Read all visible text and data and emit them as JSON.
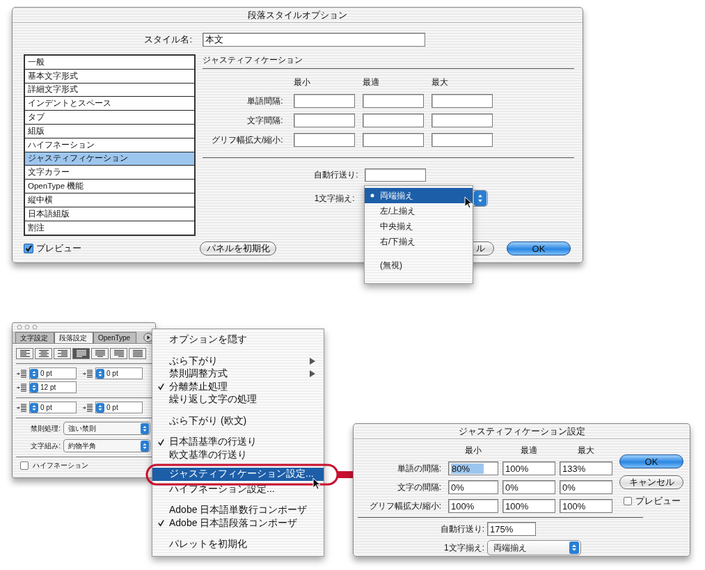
{
  "style_dialog": {
    "title": "段落スタイルオプション",
    "style_name_label": "スタイル名:",
    "style_name_value": "本文",
    "categories": [
      {
        "label": "一般",
        "selected": false
      },
      {
        "label": "基本文字形式",
        "selected": false
      },
      {
        "label": "詳細文字形式",
        "selected": false
      },
      {
        "label": "インデントとスペース",
        "selected": false
      },
      {
        "label": "タブ",
        "selected": false
      },
      {
        "label": "組版",
        "selected": false
      },
      {
        "label": "ハイフネーション",
        "selected": false
      },
      {
        "label": "ジャスティフィケーション",
        "selected": true
      },
      {
        "label": "文字カラー",
        "selected": false
      },
      {
        "label": "OpenType 機能",
        "selected": false
      },
      {
        "label": "縦中横",
        "selected": false
      },
      {
        "label": "日本語組版",
        "selected": false
      },
      {
        "label": "割注",
        "selected": false
      }
    ],
    "section_title": "ジャスティフィケーション",
    "columns": [
      "最小",
      "最適",
      "最大"
    ],
    "rows": [
      {
        "label": "単語間隔:"
      },
      {
        "label": "文字間隔:"
      },
      {
        "label": "グリフ幅拡大/縮小:"
      }
    ],
    "auto_leading_label": "自動行送り:",
    "single_char_label": "1文字揃え:",
    "preview": {
      "label": "プレビュー",
      "checked": true
    },
    "reset_button": "パネルを初期化",
    "cancel_button": "ル",
    "ok_button": "OK"
  },
  "alignment_menu": {
    "groups": [
      [
        {
          "label": "両端揃え",
          "selected": true
        },
        {
          "label": "左/上揃え",
          "selected": false
        },
        {
          "label": "中央揃え",
          "selected": false
        },
        {
          "label": "右/下揃え",
          "selected": false
        }
      ],
      [
        {
          "label": "(無視)",
          "selected": false
        }
      ]
    ]
  },
  "palette": {
    "tabs": [
      {
        "label": "文字設定",
        "selected": false
      },
      {
        "label": "段落設定",
        "selected": true
      },
      {
        "label": "OpenType",
        "selected": false
      }
    ],
    "alignment_buttons": [
      {
        "selected": false
      },
      {
        "selected": false
      },
      {
        "selected": false
      },
      {
        "selected": true
      },
      {
        "selected": false
      },
      {
        "selected": false
      },
      {
        "selected": false
      }
    ],
    "indents": [
      {
        "value": "0 pt"
      },
      {
        "value": "0 pt"
      },
      {
        "value": "12 pt"
      },
      {
        "value": "0 pt"
      },
      {
        "value": "0 pt"
      }
    ],
    "kinsoku": {
      "label": "禁則処理:",
      "value": "強い禁則"
    },
    "mojikumi": {
      "label": "文字組み:",
      "value": "約物半角"
    },
    "hyphenation": {
      "label": "ハイフネーション",
      "checked": false
    }
  },
  "panel_menu": {
    "groups": [
      [
        {
          "label": "オプションを隠す",
          "checked": false,
          "submenu": false,
          "selected": false
        }
      ],
      [
        {
          "label": "ぶら下がり",
          "checked": false,
          "submenu": true,
          "selected": false
        },
        {
          "label": "禁則調整方式",
          "checked": false,
          "submenu": true,
          "selected": false
        },
        {
          "label": "分離禁止処理",
          "checked": true,
          "submenu": false,
          "selected": false
        },
        {
          "label": "繰り返し文字の処理",
          "checked": false,
          "submenu": false,
          "selected": false
        }
      ],
      [
        {
          "label": "ぶら下がり (欧文)",
          "checked": false,
          "submenu": false,
          "selected": false
        }
      ],
      [
        {
          "label": "日本語基準の行送り",
          "checked": true,
          "submenu": false,
          "selected": false
        },
        {
          "label": "欧文基準の行送り",
          "checked": false,
          "submenu": false,
          "selected": false
        }
      ],
      [
        {
          "label": "ジャスティフィケーション設定...",
          "checked": false,
          "submenu": false,
          "selected": true
        },
        {
          "label": "ハイフネーション設定...",
          "checked": false,
          "submenu": false,
          "selected": false
        }
      ],
      [
        {
          "label": "Adobe 日本語単数行コンポーザ",
          "checked": false,
          "submenu": false,
          "selected": false
        },
        {
          "label": "Adobe 日本語段落コンポーザ",
          "checked": true,
          "submenu": false,
          "selected": false
        }
      ],
      [
        {
          "label": "パレットを初期化",
          "checked": false,
          "submenu": false,
          "selected": false
        }
      ]
    ]
  },
  "justification_dialog": {
    "title": "ジャスティフィケーション設定",
    "columns": [
      "最小",
      "最適",
      "最大"
    ],
    "rows": [
      {
        "label": "単語の間隔:",
        "values": [
          {
            "text": "80%",
            "selected": true
          },
          {
            "text": "100%",
            "selected": false
          },
          {
            "text": "133%",
            "selected": false
          }
        ]
      },
      {
        "label": "文字の間隔:",
        "values": [
          {
            "text": "0%",
            "selected": false
          },
          {
            "text": "0%",
            "selected": false
          },
          {
            "text": "0%",
            "selected": false
          }
        ]
      },
      {
        "label": "グリフ幅拡大/縮小:",
        "values": [
          {
            "text": "100%",
            "selected": false
          },
          {
            "text": "100%",
            "selected": false
          },
          {
            "text": "100%",
            "selected": false
          }
        ]
      }
    ],
    "auto_leading_label": "自動行送り:",
    "auto_leading_value": "175%",
    "single_char_label": "1文字揃え:",
    "single_char_value": "両端揃え",
    "ok_button": "OK",
    "cancel_button": "キャンセル",
    "preview": {
      "label": "プレビュー",
      "checked": false
    }
  }
}
